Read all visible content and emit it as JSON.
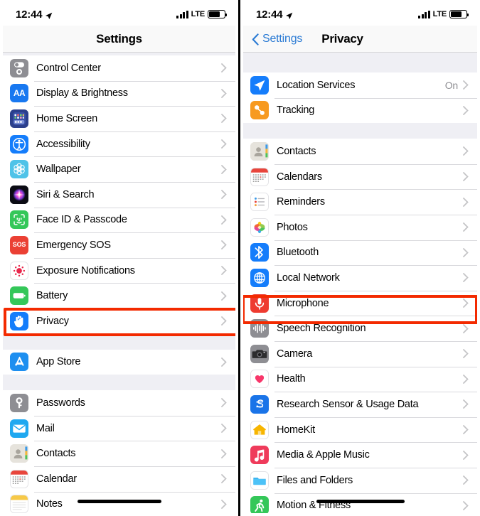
{
  "status_bar": {
    "time": "12:44",
    "location_icon": "location-arrow-icon",
    "signal_icon": "cellular-bars-icon",
    "carrier": "LTE",
    "battery_icon": "battery-icon"
  },
  "left_screen": {
    "nav": {
      "title": "Settings"
    },
    "highlight": {
      "target": "Privacy",
      "color": "#f32a00"
    },
    "groups": [
      {
        "items": [
          {
            "label": "Control Center",
            "icon": "control-center-icon",
            "value": ""
          },
          {
            "label": "Display & Brightness",
            "icon": "display-brightness-icon",
            "value": ""
          },
          {
            "label": "Home Screen",
            "icon": "home-screen-icon",
            "value": ""
          },
          {
            "label": "Accessibility",
            "icon": "accessibility-icon",
            "value": ""
          },
          {
            "label": "Wallpaper",
            "icon": "wallpaper-icon",
            "value": ""
          },
          {
            "label": "Siri & Search",
            "icon": "siri-icon",
            "value": ""
          },
          {
            "label": "Face ID & Passcode",
            "icon": "face-id-icon",
            "value": ""
          },
          {
            "label": "Emergency SOS",
            "icon": "emergency-sos-icon",
            "value": ""
          },
          {
            "label": "Exposure Notifications",
            "icon": "exposure-notifications-icon",
            "value": ""
          },
          {
            "label": "Battery",
            "icon": "battery-settings-icon",
            "value": ""
          },
          {
            "label": "Privacy",
            "icon": "privacy-hand-icon",
            "value": ""
          }
        ]
      },
      {
        "items": [
          {
            "label": "App Store",
            "icon": "app-store-icon",
            "value": ""
          }
        ]
      },
      {
        "items": [
          {
            "label": "Passwords",
            "icon": "passwords-key-icon",
            "value": ""
          },
          {
            "label": "Mail",
            "icon": "mail-icon",
            "value": ""
          },
          {
            "label": "Contacts",
            "icon": "contacts-icon",
            "value": ""
          },
          {
            "label": "Calendar",
            "icon": "calendar-icon",
            "value": ""
          },
          {
            "label": "Notes",
            "icon": "notes-icon",
            "value": ""
          }
        ]
      }
    ]
  },
  "right_screen": {
    "nav": {
      "back_label": "Settings",
      "back_icon": "chevron-left-icon",
      "title": "Privacy"
    },
    "highlight": {
      "target": "Microphone",
      "color": "#f32a00"
    },
    "groups": [
      {
        "items": [
          {
            "label": "Location Services",
            "icon": "location-services-icon",
            "value": "On"
          },
          {
            "label": "Tracking",
            "icon": "tracking-icon",
            "value": ""
          }
        ]
      },
      {
        "items": [
          {
            "label": "Contacts",
            "icon": "contacts-icon",
            "value": ""
          },
          {
            "label": "Calendars",
            "icon": "calendar-icon",
            "value": ""
          },
          {
            "label": "Reminders",
            "icon": "reminders-icon",
            "value": ""
          },
          {
            "label": "Photos",
            "icon": "photos-icon",
            "value": ""
          },
          {
            "label": "Bluetooth",
            "icon": "bluetooth-icon",
            "value": ""
          },
          {
            "label": "Local Network",
            "icon": "local-network-icon",
            "value": ""
          },
          {
            "label": "Microphone",
            "icon": "microphone-icon",
            "value": ""
          },
          {
            "label": "Speech Recognition",
            "icon": "speech-recognition-icon",
            "value": ""
          },
          {
            "label": "Camera",
            "icon": "camera-icon",
            "value": ""
          },
          {
            "label": "Health",
            "icon": "health-heart-icon",
            "value": ""
          },
          {
            "label": "Research Sensor & Usage Data",
            "icon": "research-sensor-icon",
            "value": ""
          },
          {
            "label": "HomeKit",
            "icon": "homekit-icon",
            "value": ""
          },
          {
            "label": "Media & Apple Music",
            "icon": "media-music-icon",
            "value": ""
          },
          {
            "label": "Files and Folders",
            "icon": "files-folders-icon",
            "value": ""
          },
          {
            "label": "Motion & Fitness",
            "icon": "motion-fitness-icon",
            "value": ""
          }
        ]
      }
    ]
  }
}
